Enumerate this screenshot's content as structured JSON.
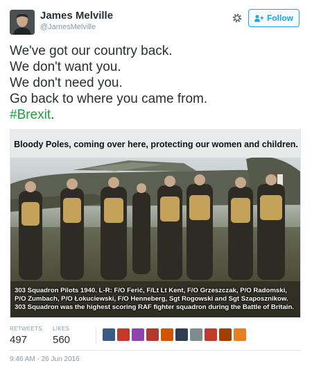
{
  "user": {
    "display_name": "James Melville",
    "handle": "@JamesMelville"
  },
  "follow_label": "Follow",
  "tweet_lines": [
    "We've got our country back.",
    "We don't want you.",
    "We don't need you.",
    "Go back to where you came from."
  ],
  "hashtag": "#Brexit",
  "hashtag_suffix": ".",
  "hashtag_color": "#1b9e3b",
  "photo": {
    "caption_top": "Bloody Poles, coming over here, protecting our women and children.",
    "caption_bottom": [
      "303 Squadron Pilots 1940. L-R: F/O Ferić, F/Lt Lt Kent, F/O Grzeszczak, P/O Radomski,",
      "P/O Zumbach, P/O Łokuciewski, F/O Henneberg, Sgt Rogowski and Sgt Szaposznikow.",
      "303 Squadron was the highest scoring RAF fighter squadron during the Battle of Britain."
    ]
  },
  "stats": {
    "retweets_label": "RETWEETS",
    "retweets_value": "497",
    "likes_label": "LIKES",
    "likes_value": "560"
  },
  "liker_avatar_colors": [
    "#3d5a80",
    "#c0392b",
    "#8e44ad",
    "#b03a2e",
    "#d35400",
    "#2c3e50",
    "#7f8c8d",
    "#c0392b",
    "#a04000",
    "#e67e22"
  ],
  "timestamp": "9:46 AM - 26 Jun 2016",
  "accent_color": "#1da1f2"
}
